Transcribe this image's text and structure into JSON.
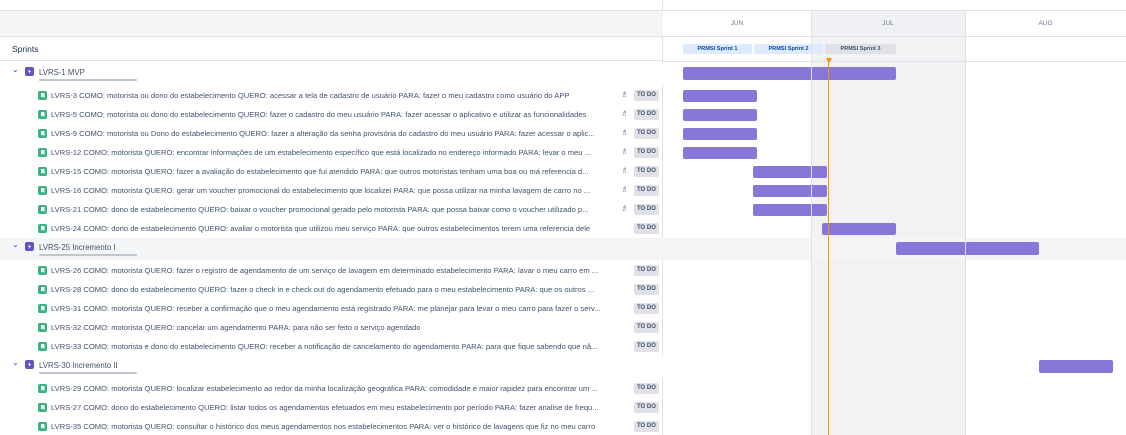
{
  "sprints_label": "Sprints",
  "colors": {
    "epic": "#6554c0",
    "story": "#36b37e",
    "bar": "#8777d9",
    "today": "#ff8b00",
    "status_bg": "#dfe1e6"
  },
  "months": [
    "JUN",
    "JUL",
    "AUG"
  ],
  "sprints": [
    {
      "name": "PRMSI Sprint 1",
      "state": "active"
    },
    {
      "name": "PRMSI Sprint 2",
      "state": "active"
    },
    {
      "name": "PRMSI Sprint 3",
      "state": "future"
    }
  ],
  "epics": [
    {
      "key_title": "LVRS-1  MVP",
      "expanded": true,
      "progress_fraction": 0.8,
      "stories": [
        {
          "text": "LVRS-3  COMO: motorista ou dono do estabelecimento QUERO: acessar a tela de cadastro de usuário PARA: fazer o meu cadastro como usuário do APP",
          "status": "TO DO",
          "assignee_icon": "user-icon"
        },
        {
          "text": "LVRS-5  COMO: motorista ou dono do estabelecimento QUERO: fazer o cadastro do meu usuário PARA: fazer acessar o aplicativo e utilizar as funcionalidades",
          "status": "TO DO",
          "assignee_icon": "user-icon"
        },
        {
          "text": "LVRS-9  COMO: motorista ou Dono do estabelecimento QUERO: fazer a alteração da senha provisória do cadastro do meu usuário PARA: fazer acessar o aplic...",
          "status": "TO DO",
          "assignee_icon": "user-icon"
        },
        {
          "text": "LVRS-12  COMO: motorista QUERO: encontrar informações de um estabelecimento específico que está localizado no endereço informado PARA: levar o meu ...",
          "status": "TO DO",
          "assignee_icon": "user-icon"
        },
        {
          "text": "LVRS-15  COMO: motorista QUERO: fazer a avaliação do estabelecimento que fui atendido PARA: que outros motoristas tenham uma boa ou má referencia d...",
          "status": "TO DO",
          "assignee_icon": "user-icon"
        },
        {
          "text": "LVRS-16  COMO: motorista QUERO: gerar um voucher promocional do estabelecimento que localizei PARA: que possa utilizar na minha lavagem de carro no ...",
          "status": "TO DO",
          "assignee_icon": "user-icon"
        },
        {
          "text": "LVRS-21  COMO: dono de estabelecimento QUERO: baixar o voucher promocional gerado pelo motorista PARA: que possa baixar como o voucher utilizado p...",
          "status": "TO DO",
          "assignee_icon": "user-icon"
        },
        {
          "text": "LVRS-24  COMO: dono de estabelecimento QUERO: avaliar o motorista que utilizou meu serviço PARA: que outros estabelecimentos terem uma referencia dele",
          "status": "TO DO",
          "assignee_icon": ""
        }
      ]
    },
    {
      "key_title": "LVRS-25  Incremento I",
      "expanded": true,
      "progress_fraction": 0.0,
      "stories": [
        {
          "text": "LVRS-26  COMO: motorista QUERO: fazer o registro de agendamento de um serviço de lavagem em determinado estabelecimento PARA: lavar o meu carro em ...",
          "status": "TO DO",
          "assignee_icon": ""
        },
        {
          "text": "LVRS-28  COMO: dono do estabelecimento QUERO: fazer o check in e check out do agendamento efetuado para o meu estabelecimento PARA: que os outros ...",
          "status": "TO DO",
          "assignee_icon": ""
        },
        {
          "text": "LVRS-31  COMO: motorista QUERO: receber a confirmação que o meu agendamento está registrado PARA: me planejar para levar o meu carro para fazer o serv...",
          "status": "TO DO",
          "assignee_icon": ""
        },
        {
          "text": "LVRS-32  COMO: motorista QUERO: cancelar um agendamento PARA: para não ser feito o serviço agendado",
          "status": "TO DO",
          "assignee_icon": ""
        },
        {
          "text": "LVRS-33  COMO: motorista e dono do estabelecimento QUERO: receber a notificação de cancelamento do agendamento PARA: para que fique sabendo que nã...",
          "status": "TO DO",
          "assignee_icon": ""
        }
      ]
    },
    {
      "key_title": "LVRS-30  Incremento II",
      "expanded": true,
      "progress_fraction": 0.0,
      "stories": [
        {
          "text": "LVRS-29  COMO: motorista QUERO: localizar estabelecimento ao redor da minha localização geográfica PARA: comodidade e maior rapidez para encontrar um ...",
          "status": "TO DO",
          "assignee_icon": ""
        },
        {
          "text": "LVRS-27  COMO: dono do estabelecimento QUERO: listar todos os agendamentos efetuados em meu estabelecimento por período PARA: fazer analise de frequ...",
          "status": "TO DO",
          "assignee_icon": ""
        },
        {
          "text": "LVRS-35  COMO: motorista QUERO: consultar o histórico dos meus agendamentos nos estabelecimentos PARA: ver o histórico de lavagens que fiz no meu carro",
          "status": "TO DO",
          "assignee_icon": ""
        }
      ]
    }
  ]
}
